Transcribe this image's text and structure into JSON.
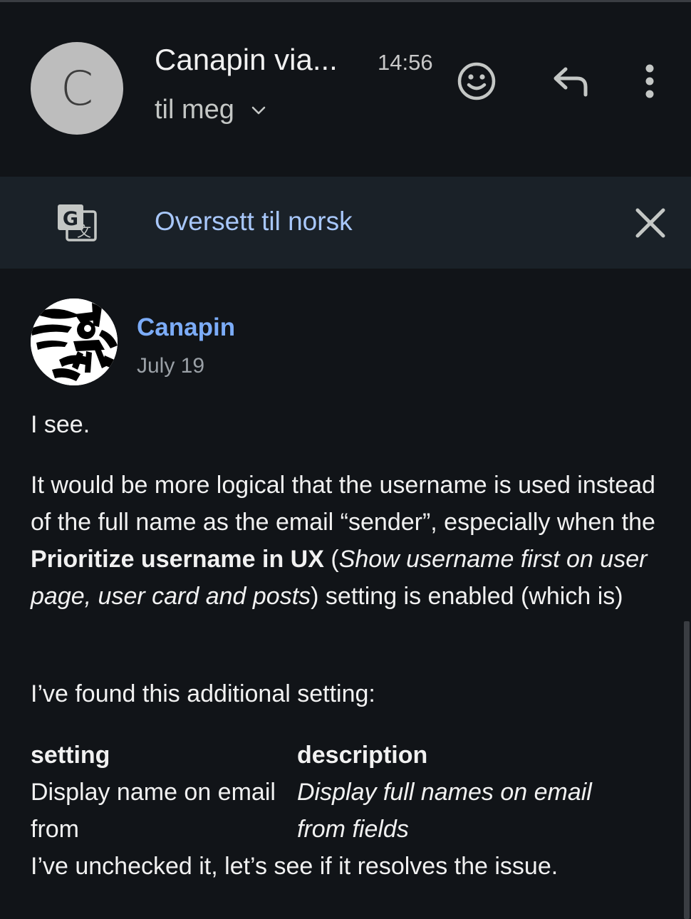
{
  "header": {
    "avatar_letter": "C",
    "sender_name": "Canapin via...",
    "time": "14:56",
    "recipient": "til meg",
    "icons": {
      "emoji": "smiley-icon",
      "reply": "reply-arrow-icon",
      "more": "more-vertical-icon",
      "expand": "chevron-down-icon"
    }
  },
  "translate_bar": {
    "link_text": "Oversett til norsk",
    "icons": {
      "translate": "google-translate-icon",
      "close": "close-icon"
    }
  },
  "post": {
    "author": "Canapin",
    "date": "July 19",
    "p1": "I see.",
    "p2_part1": "It would be more logical that the username is used instead of the full name as the email “sender”, especially when the ",
    "p2_bold": "Prioritize username in UX",
    "p2_part2": " (",
    "p2_italic": "Show username first on user page, user card and posts",
    "p2_part3": ") setting is enabled (which is)",
    "p3": "I’ve found this additional setting:",
    "table": {
      "headers": [
        "setting",
        "description"
      ],
      "rows": [
        [
          "Display name on email from",
          "Display full names on email from fields"
        ]
      ]
    },
    "p4": "I’ve unchecked it, let’s see if it resolves the issue."
  },
  "colors": {
    "background": "#111418",
    "translate_bar": "#1a2128",
    "link": "#a8c7fa",
    "author": "#7cacf8"
  }
}
